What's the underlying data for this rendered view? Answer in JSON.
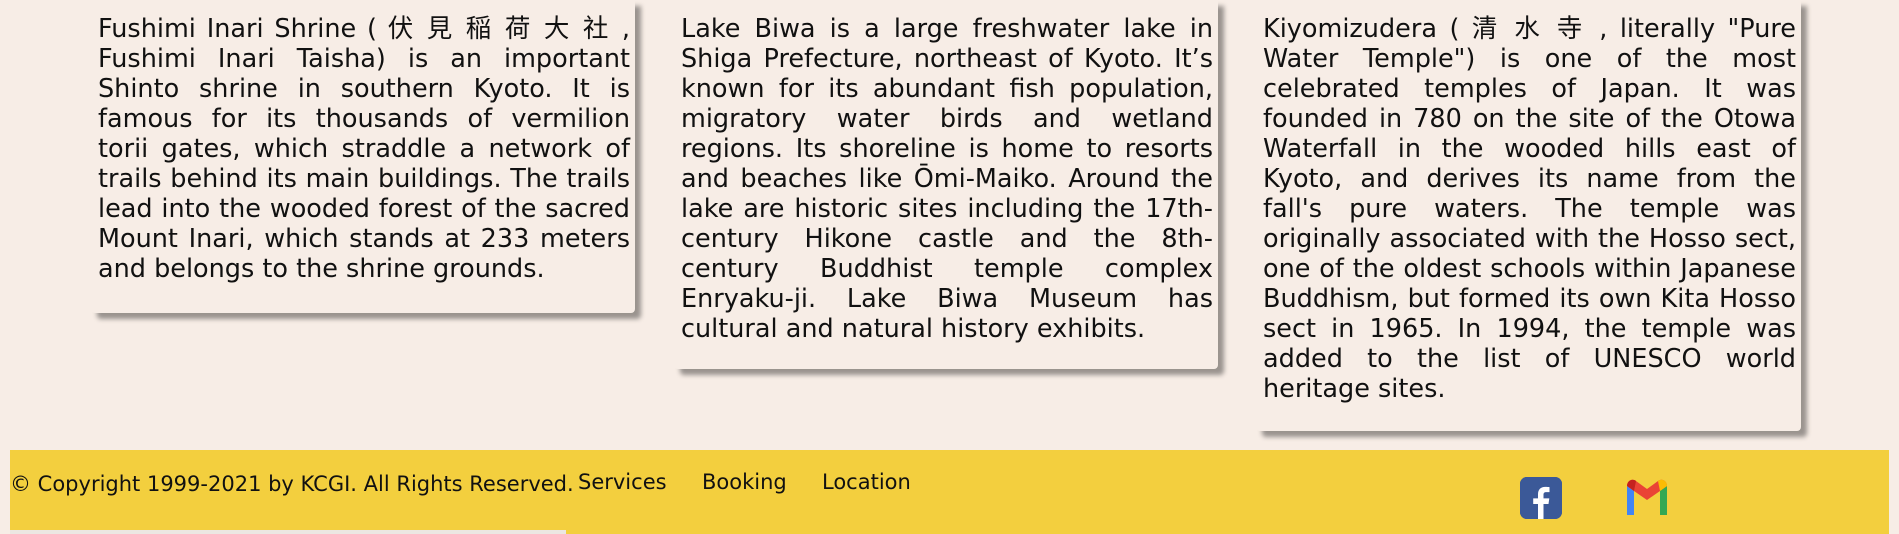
{
  "cards": [
    {
      "text": "Fushimi Inari Shrine ( 伏 見 稲 荷 大 社 , Fushimi Inari Taisha) is an important Shinto shrine in southern Kyoto. It is famous for its thousands of vermilion torii gates, which straddle a network of trails behind its main buildings. The trails lead into the wooded forest of the sacred Mount Inari, which stands at 233 meters and belongs to the shrine grounds."
    },
    {
      "text": "Lake Biwa is a large freshwater lake in Shiga Prefecture, northeast of Kyoto. It’s known for its abundant fish population, migratory water birds and wetland regions. Its shoreline is home to resorts and beaches like Ōmi-Maiko. Around the lake are historic sites including the 17th-century Hikone castle and the 8th-century Buddhist temple complex Enryaku-ji. Lake Biwa Museum has cultural and natural history exhibits."
    },
    {
      "text": "Kiyomizudera ( 清 水 寺 , literally \"Pure Water Temple\") is one of the most celebrated temples of Japan. It was founded in 780 on the site of the Otowa Waterfall in the wooded hills east of Kyoto, and derives its name from the fall's pure waters. The temple was originally associated with the Hosso sect, one of the oldest schools within Japanese Buddhism, but formed its own Kita Hosso sect in 1965. In 1994, the temple was added to the list of UNESCO world heritage sites."
    }
  ],
  "footer": {
    "copyright": "© Copyright 1999-2021 by KCGI. All Rights Reserved.",
    "nav": {
      "services": "Services",
      "booking": "Booking",
      "location": "Location"
    },
    "social": {
      "facebook_icon": "facebook-icon",
      "gmail_icon": "gmail-icon"
    }
  },
  "colors": {
    "page_background": "#f7ede6",
    "footer_background": "#f3cf3e",
    "facebook_blue": "#3b5998"
  }
}
